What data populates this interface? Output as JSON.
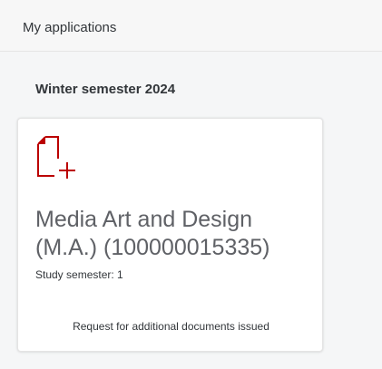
{
  "header": {
    "title": "My applications"
  },
  "section": {
    "heading": "Winter semester 2024"
  },
  "application_card": {
    "icon": "document-add-icon",
    "title": "Media Art and Design (M.A.) (100000015335)",
    "subtitle": "Study semester: 1",
    "status": "Request for additional documents issued"
  },
  "colors": {
    "icon_accent": "#bb0000",
    "background": "#f5f6f7",
    "card_background": "#ffffff"
  }
}
